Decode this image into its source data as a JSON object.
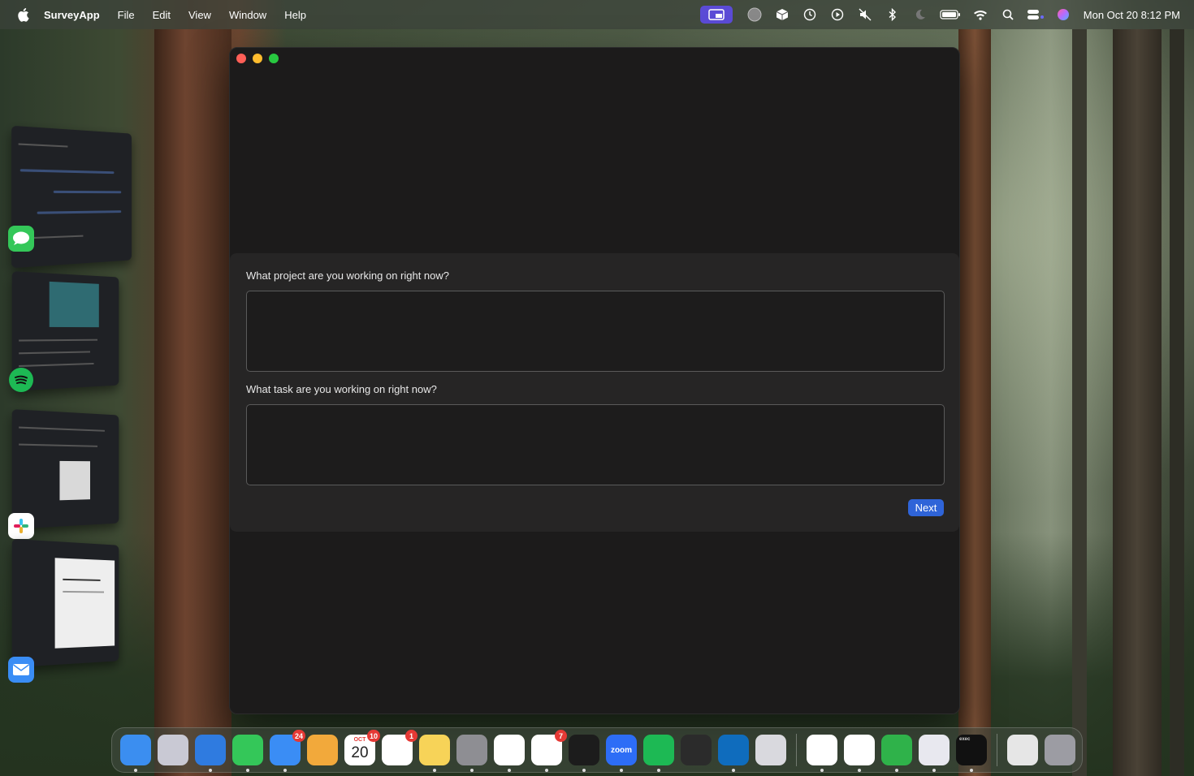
{
  "menubar": {
    "app_name": "SurveyApp",
    "menus": [
      "File",
      "Edit",
      "View",
      "Window",
      "Help"
    ],
    "clock": "Mon Oct 20  8:12 PM",
    "status_icons": [
      "screen-share-icon",
      "globe-icon",
      "box-icon",
      "time-machine-icon",
      "play-icon",
      "mute-icon",
      "bluetooth-icon",
      "moon-icon",
      "battery-icon",
      "wifi-icon",
      "search-icon",
      "control-center-icon",
      "siri-icon"
    ]
  },
  "survey": {
    "q1_label": "What project are you working on right now?",
    "q1_value": "",
    "q2_label": "What task are you working on right now?",
    "q2_value": "",
    "next_label": "Next"
  },
  "dock": {
    "items": [
      {
        "name": "finder",
        "color": "#3b8ef0",
        "badge": "",
        "running": true
      },
      {
        "name": "launchpad",
        "color": "#c9c9d4",
        "badge": "",
        "running": false
      },
      {
        "name": "safari",
        "color": "#2f7be0",
        "badge": "",
        "running": true
      },
      {
        "name": "messages",
        "color": "#34c759",
        "badge": "",
        "running": true
      },
      {
        "name": "mail",
        "color": "#3a8df5",
        "badge": "24",
        "running": true
      },
      {
        "name": "photos",
        "color": "#f2a93b",
        "badge": "",
        "running": false
      },
      {
        "name": "calendar",
        "color": "#ffffff",
        "badge": "10",
        "running": false,
        "month": "OCT",
        "day": "20"
      },
      {
        "name": "reminders",
        "color": "#ffffff",
        "badge": "1",
        "running": false
      },
      {
        "name": "notes",
        "color": "#f7d358",
        "badge": "",
        "running": true
      },
      {
        "name": "system-settings",
        "color": "#8e8e93",
        "badge": "",
        "running": true
      },
      {
        "name": "chatgpt",
        "color": "#ffffff",
        "badge": "",
        "running": true
      },
      {
        "name": "slack",
        "color": "#ffffff",
        "badge": "7",
        "running": true
      },
      {
        "name": "terminal",
        "color": "#1c1c1c",
        "badge": "",
        "running": true
      },
      {
        "name": "zoom",
        "color": "#2d6df6",
        "badge": "",
        "running": true,
        "text": "zoom"
      },
      {
        "name": "spotify",
        "color": "#1db954",
        "badge": "",
        "running": true
      },
      {
        "name": "cursor",
        "color": "#2b2b2b",
        "badge": "",
        "running": false
      },
      {
        "name": "outlook",
        "color": "#0f6cbd",
        "badge": "",
        "running": true
      },
      {
        "name": "iphone-mirroring",
        "color": "#d9d9de",
        "badge": "",
        "running": false
      },
      {
        "name": "chrome",
        "color": "#ffffff",
        "badge": "",
        "running": true
      },
      {
        "name": "zotero",
        "color": "#ffffff",
        "badge": "",
        "running": true
      },
      {
        "name": "numbers",
        "color": "#2fb24a",
        "badge": "",
        "running": true
      },
      {
        "name": "keychain",
        "color": "#e8e8ef",
        "badge": "",
        "running": true
      },
      {
        "name": "exec",
        "color": "#111111",
        "badge": "",
        "running": true,
        "text": "exec"
      },
      {
        "name": "downloads-stack",
        "color": "#e6e6e6",
        "badge": "",
        "running": false
      },
      {
        "name": "trash",
        "color": "#9c9ca3",
        "badge": "",
        "running": false
      }
    ]
  }
}
